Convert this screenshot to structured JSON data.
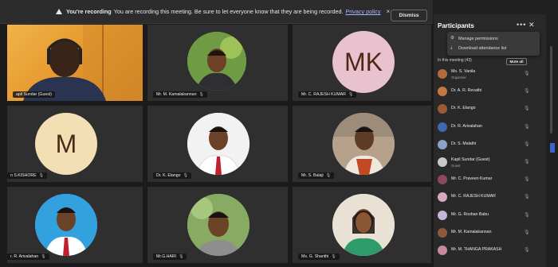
{
  "banner": {
    "title": "You're recording",
    "message": "You are recording this meeting. Be sure to let everyone know that they are being recorded.",
    "link": "Privacy policy",
    "dismiss_label": "Dismiss"
  },
  "tiles": [
    {
      "name": "apil Sundar (Guest)"
    },
    {
      "name": "Mr. M. Kamalakannan"
    },
    {
      "name": "Mr. C. RAJESH KUMAR",
      "initials": "MK"
    },
    {
      "name": "n S.KISHORE",
      "initials": "M"
    },
    {
      "name": "Dr. K. Elango"
    },
    {
      "name": "Mr. S. Balaji"
    },
    {
      "name": "r. R. Arivalahan"
    },
    {
      "name": "Mr.G.HARI"
    },
    {
      "name": "Ms. G. Shanthi"
    }
  ],
  "panel": {
    "title": "Participants",
    "more_icon": "more-icon",
    "menu": [
      "Manage permissions",
      "Download attendance list"
    ],
    "section_label": "In this meeting (43)",
    "mute_all": "Mute all",
    "participants": [
      {
        "name": "Ms. S. Vanila",
        "role": "Organizer",
        "color": "#b46a3c"
      },
      {
        "name": "Dr. A. R. Revathi",
        "role": "",
        "color": "#c2783e"
      },
      {
        "name": "Dr. K. Elango",
        "role": "",
        "color": "#9c5a34"
      },
      {
        "name": "Dr. R. Arivalahan",
        "role": "",
        "color": "#3f6ab0"
      },
      {
        "name": "Dr. S. Malathi",
        "role": "",
        "color": "#8fa1c9"
      },
      {
        "name": "Kapil Sundar (Guest)",
        "role": "Guest",
        "color": "#c9c9c9"
      },
      {
        "name": "Mr. C. Praveen Kumar",
        "role": "",
        "color": "#8a4a5c"
      },
      {
        "name": "Mr. C. RAJESH KUMAR",
        "role": "",
        "color": "#d6a9c0"
      },
      {
        "name": "Mr. G. Roshan Babu",
        "role": "",
        "color": "#c4b6d6"
      },
      {
        "name": "Mr. M. Kamalakannan",
        "role": "",
        "color": "#8d5b3c"
      },
      {
        "name": "Mr. M. THANGA PRAKASH",
        "role": "",
        "color": "#c98aa0"
      }
    ]
  }
}
